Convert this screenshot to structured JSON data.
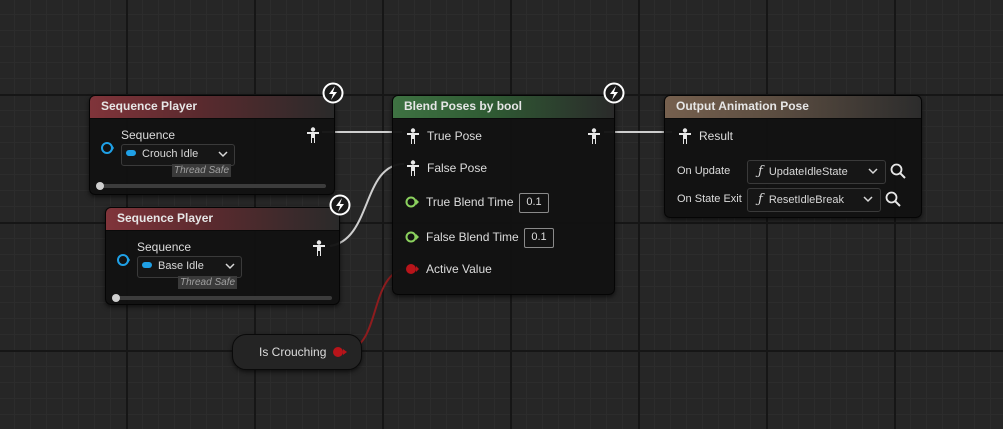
{
  "colors": {
    "pose_wire": "#cfcfcf",
    "float_pin": "#8bd15e",
    "bool_pin": "#b8141a",
    "asset_blue": "#1fa0e6",
    "header_red": "#80343a",
    "header_green": "#3e7242",
    "header_tan": "#76604e"
  },
  "icons": {
    "pose": "pose-pin-icon",
    "lightning": "lightning-icon",
    "search": "search-icon",
    "chevron": "chevron-down-icon",
    "function": "function-icon"
  },
  "nodes": {
    "seq1": {
      "title": "Sequence Player",
      "sequence_label": "Sequence",
      "asset": "Crouch Idle",
      "thread": "Thread Safe"
    },
    "seq2": {
      "title": "Sequence Player",
      "sequence_label": "Sequence",
      "asset": "Base Idle",
      "thread": "Thread Safe"
    },
    "blend": {
      "title": "Blend Poses by bool",
      "true_pose": "True Pose",
      "false_pose": "False Pose",
      "true_blend_time_label": "True Blend Time",
      "true_blend_time": "0.1",
      "false_blend_time_label": "False Blend Time",
      "false_blend_time": "0.1",
      "active_value": "Active Value"
    },
    "output": {
      "title": "Output Animation Pose",
      "result": "Result",
      "on_update_label": "On Update",
      "on_update_fn": "UpdateIdleState",
      "on_exit_label": "On State Exit",
      "on_exit_fn": "ResetIdleBreak"
    },
    "var": {
      "label": "Is Crouching"
    }
  }
}
